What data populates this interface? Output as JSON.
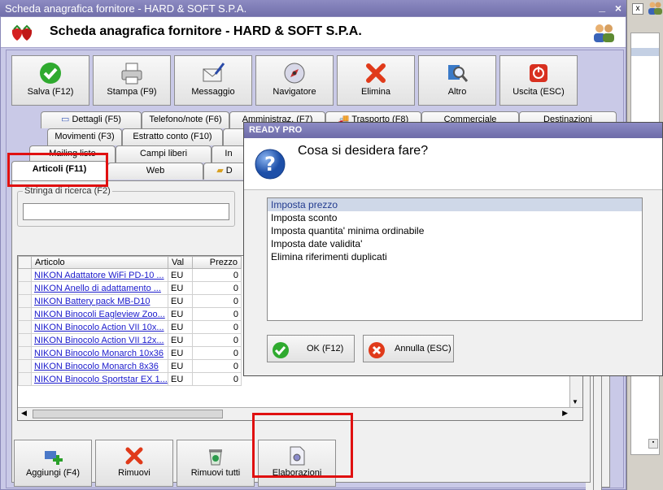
{
  "window": {
    "title": "Scheda anagrafica fornitore - HARD & SOFT S.P.A.",
    "header_title": "Scheda anagrafica fornitore - HARD & SOFT S.P.A.",
    "minimize_glyph": "_",
    "close_glyph": "×"
  },
  "toolbar": {
    "salva": "Salva (F12)",
    "stampa": "Stampa (F9)",
    "messaggio": "Messaggio",
    "navigatore": "Navigatore",
    "elimina": "Elimina",
    "altro": "Altro",
    "uscita": "Uscita (ESC)"
  },
  "tabs": {
    "row1": [
      "Dettagli (F5)",
      "Telefono/note (F6)",
      "Amministraz. (F7)",
      "Trasporto (F8)",
      "Commerciale",
      "Destinazioni"
    ],
    "row2": [
      "Movimenti (F3)",
      "Estratto conto (F10)"
    ],
    "row3": [
      "Mailing liste",
      "Campi liberi",
      "In"
    ],
    "row4": [
      "Articoli (F11)",
      "Web",
      "D"
    ]
  },
  "search": {
    "label": "Stringa di ricerca (F2)",
    "value": ""
  },
  "grid": {
    "columns": [
      "Articolo",
      "Val",
      "Prezzo"
    ],
    "rows": [
      {
        "articolo": "NIKON Adattatore WiFi PD-10 ...",
        "val": "EU",
        "prezzo": "0"
      },
      {
        "articolo": "NIKON Anello di adattamento ...",
        "val": "EU",
        "prezzo": "0"
      },
      {
        "articolo": "NIKON Battery pack MB-D10",
        "val": "EU",
        "prezzo": "0"
      },
      {
        "articolo": "NIKON Binocoli Eagleview Zoo...",
        "val": "EU",
        "prezzo": "0"
      },
      {
        "articolo": "NIKON Binocolo Action VII 10x...",
        "val": "EU",
        "prezzo": "0"
      },
      {
        "articolo": "NIKON Binocolo Action VII 12x...",
        "val": "EU",
        "prezzo": "0"
      },
      {
        "articolo": "NIKON Binocolo Monarch 10x36",
        "val": "EU",
        "prezzo": "0"
      },
      {
        "articolo": "NIKON Binocolo Monarch 8x36",
        "val": "EU",
        "prezzo": "0"
      },
      {
        "articolo": "NIKON Binocolo Sportstar EX 1...",
        "val": "EU",
        "prezzo": "0"
      }
    ]
  },
  "bottom_buttons": {
    "aggiungi": "Aggiungi (F4)",
    "rimuovi": "Rimuovi",
    "rimuovi_tutti": "Rimuovi tutti",
    "elaborazioni": "Elaborazioni"
  },
  "dialog": {
    "title": "READY PRO",
    "question": "Cosa si desidera fare?",
    "options": [
      "Imposta prezzo",
      "Imposta sconto",
      "Imposta quantita' minima ordinabile",
      "Imposta date validita'",
      "Elimina riferimenti duplicati"
    ],
    "selected_option": "Imposta prezzo",
    "ok": "OK (F12)",
    "annulla": "Annulla (ESC)"
  },
  "colors": {
    "accent_titlebar": "#7775b4",
    "highlight_red": "#e01010",
    "link_blue": "#1a1acc"
  }
}
